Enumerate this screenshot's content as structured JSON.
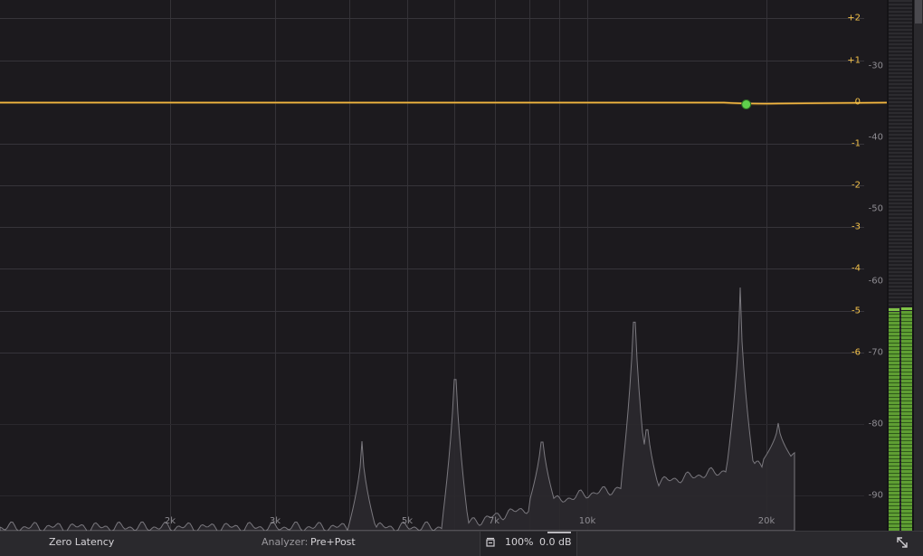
{
  "eq_display": {
    "gain_scale_labels": [
      "+2",
      "+1",
      "0",
      "-1",
      "-2",
      "-3",
      "-4",
      "-5",
      "-6"
    ],
    "analyzer_scale_labels": [
      "-30",
      "-40",
      "-50",
      "-60",
      "-70",
      "-80",
      "-90"
    ],
    "frequency_labels": [
      "2k",
      "3k",
      "5k",
      "7k",
      "10k",
      "20k"
    ],
    "eq_curve_color": "#f2b540",
    "band_node": {
      "color": "#5fd14c",
      "frequency_hz": 18500,
      "gain_db": -0.05
    },
    "spectrum_color": "#7a787e"
  },
  "level_meter": {
    "color": "#5f9e33",
    "channels": [
      {
        "name": "left",
        "level_db": -5
      },
      {
        "name": "right",
        "level_db": -4.8
      }
    ]
  },
  "status_bar": {
    "latency_mode": "Zero Latency",
    "analyzer_label": "Analyzer:",
    "analyzer_value": "Pre+Post",
    "scale": "100%",
    "output_gain": "0.0 dB",
    "icons": [
      "mode-icon",
      "expand-icon"
    ]
  }
}
